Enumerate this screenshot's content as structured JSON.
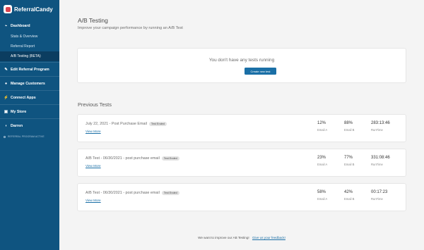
{
  "brand": {
    "name": "ReferralCandy"
  },
  "sidebar": {
    "dashboard": "Dashboard",
    "sub_items": [
      "Stats & Overview",
      "Referral Report",
      "A/B Testing (BETA)"
    ],
    "items": [
      {
        "label": "Edit Referral Program",
        "icon": "edit-icon"
      },
      {
        "label": "Manage Customers",
        "icon": "users-icon"
      },
      {
        "label": "Connect Apps",
        "icon": "plug-icon"
      },
      {
        "label": "My Store",
        "icon": "store-icon"
      }
    ],
    "user": "Darren",
    "status": "REFERRAL PROGRAM ACTIVE"
  },
  "page": {
    "title": "A/B Testing",
    "subtitle": "Improve your campaign performance by running an A/B Test"
  },
  "empty_state": {
    "message": "You don't have any tests running",
    "button": "Create new test"
  },
  "previous": {
    "title": "Previous Tests",
    "tests": [
      {
        "name": "July 22, 2021 - Post Purchase Email",
        "badge": "Test Ended",
        "link": "View More",
        "a": "12%",
        "a_label": "Email A",
        "b": "88%",
        "b_label": "Email B",
        "run": "283:13:46",
        "run_label": "RunTime"
      },
      {
        "name": "A/B Test - 06/30/2021 - post purchase email",
        "badge": "Test Ended",
        "link": "View More",
        "a": "23%",
        "a_label": "Email A",
        "b": "77%",
        "b_label": "Email B",
        "run": "331:08:46",
        "run_label": "RunTime"
      },
      {
        "name": "A/B Test - 06/30/2021 - post purchase email",
        "badge": "Test Ended",
        "link": "View More",
        "a": "58%",
        "a_label": "Email A",
        "b": "42%",
        "b_label": "Email B",
        "run": "00:17:23",
        "run_label": "RunTime"
      }
    ]
  },
  "footer": {
    "text": "We want to improve our AB Testing!",
    "link": "Give us your feedback!"
  }
}
